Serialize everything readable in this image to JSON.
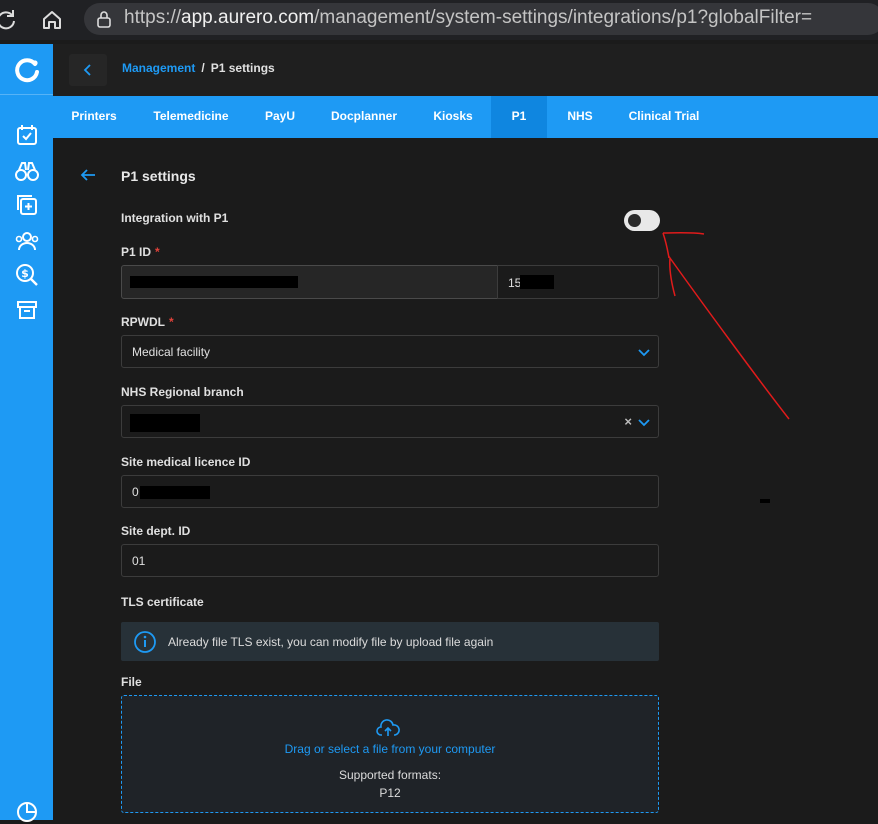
{
  "browser": {
    "url_host": "app.aurero.com",
    "url_prefix": "https://",
    "url_path": "/management/system-settings/integrations/p1?globalFilter="
  },
  "breadcrumb": {
    "parent": "Management",
    "separator": "/",
    "current": "P1 settings"
  },
  "tabs": [
    {
      "label": "Printers"
    },
    {
      "label": "Telemedicine"
    },
    {
      "label": "PayU"
    },
    {
      "label": "Docplanner"
    },
    {
      "label": "Kiosks"
    },
    {
      "label": "P1",
      "active": true
    },
    {
      "label": "NHS"
    },
    {
      "label": "Clinical Trial"
    }
  ],
  "page": {
    "title": "P1 settings",
    "integration_label": "Integration with P1",
    "integration_enabled": false,
    "p1_id_label": "P1 ID",
    "p1_id_required": "*",
    "p1_id_suffix_value": "15",
    "rpwdl_label": "RPWDL",
    "rpwdl_required": "*",
    "rpwdl_value": "Medical facility",
    "nhs_branch_label": "NHS Regional branch",
    "nhs_branch_clear": "×",
    "licence_label": "Site medical licence ID",
    "licence_value": "0",
    "dept_label": "Site dept. ID",
    "dept_value": "01",
    "tls_label": "TLS certificate",
    "tls_info": "Already file TLS exist, you can modify file by upload file again",
    "file_label": "File",
    "dropzone_link": "Drag or select a file from your computer",
    "dropzone_formats": "Supported formats:",
    "dropzone_ext": "P12"
  },
  "colors": {
    "accent": "#1e9af4",
    "annotation": "#e01b1b"
  }
}
